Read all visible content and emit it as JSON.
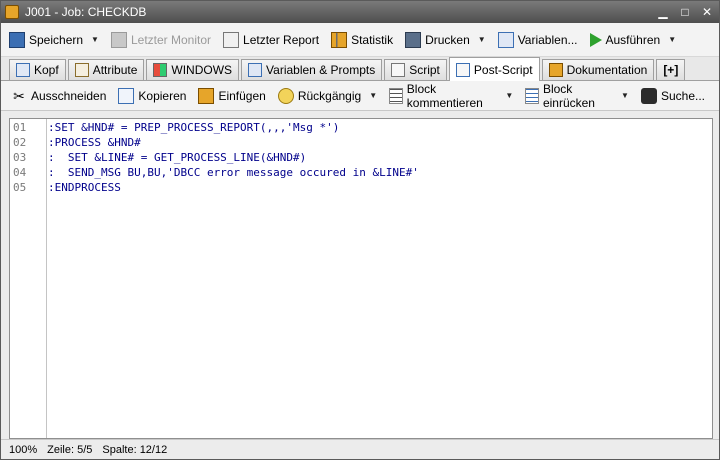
{
  "window": {
    "title": "J001 - Job: CHECKDB"
  },
  "toolbar": {
    "save": "Speichern",
    "last_monitor": "Letzter Monitor",
    "last_report": "Letzter Report",
    "statistics": "Statistik",
    "print": "Drucken",
    "variables": "Variablen...",
    "execute": "Ausführen"
  },
  "tabs": [
    {
      "label": "Kopf"
    },
    {
      "label": "Attribute"
    },
    {
      "label": "WINDOWS"
    },
    {
      "label": "Variablen & Prompts"
    },
    {
      "label": "Script"
    },
    {
      "label": "Post-Script"
    },
    {
      "label": "Dokumentation"
    },
    {
      "label": "[+]"
    }
  ],
  "editbar": {
    "cut": "Ausschneiden",
    "copy": "Kopieren",
    "paste": "Einfügen",
    "undo": "Rückgängig",
    "comment_block": "Block kommentieren",
    "indent_block": "Block einrücken",
    "search": "Suche..."
  },
  "editor": {
    "line_numbers": [
      "01",
      "02",
      "03",
      "04",
      "05"
    ],
    "lines": [
      ":SET &HND# = PREP_PROCESS_REPORT(,,,'Msg *')",
      ":PROCESS &HND#",
      ":  SET &LINE# = GET_PROCESS_LINE(&HND#)",
      ":  SEND_MSG BU,BU,'DBCC error message occured in &LINE#'",
      ":ENDPROCESS"
    ]
  },
  "status": {
    "zoom": "100%",
    "line": "Zeile: 5/5",
    "column": "Spalte: 12/12"
  },
  "colors": {
    "accent": "#e6a52a",
    "title_bg": "#5a5a5a"
  }
}
